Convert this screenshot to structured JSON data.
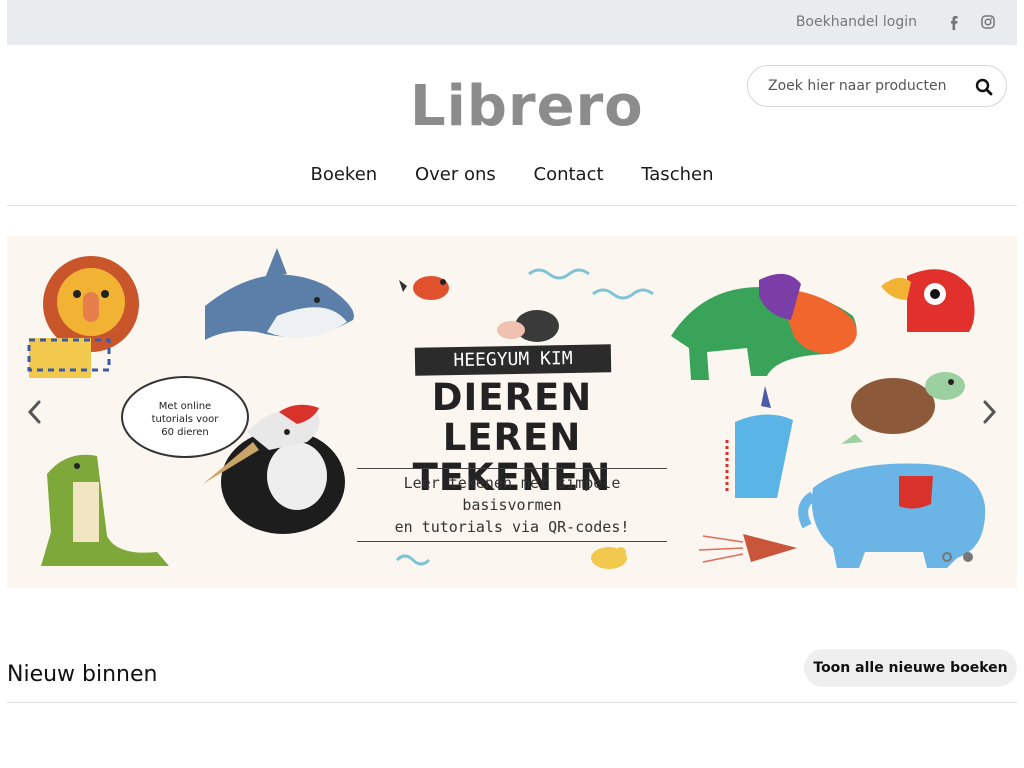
{
  "topbar": {
    "login_label": "Boekhandel login",
    "facebook_icon": "facebook-icon",
    "instagram_icon": "instagram-icon"
  },
  "logo": {
    "text": "Librero",
    "color": "#8c8c8c"
  },
  "search": {
    "placeholder": "Zoek hier naar producten",
    "value": "",
    "icon": "search-icon"
  },
  "nav": {
    "items": [
      "Boeken",
      "Over ons",
      "Contact",
      "Taschen"
    ]
  },
  "slider": {
    "author": "HEEGYUM KIM",
    "title_line1": "DIEREN LEREN",
    "title_line2": "TEKENEN",
    "subtitle_line1": "Leer tekenen met simpele basisvormen",
    "subtitle_line2": "en tutorials via QR-codes!",
    "bubble_line1": "Met online",
    "bubble_line2": "tutorials voor",
    "bubble_line3": "60 dieren",
    "slide_count": 2,
    "active_slide": 1,
    "background": "#fbf6f0"
  },
  "new_section": {
    "title": "Nieuw binnen",
    "button_label": "Toon alle nieuwe boeken"
  }
}
